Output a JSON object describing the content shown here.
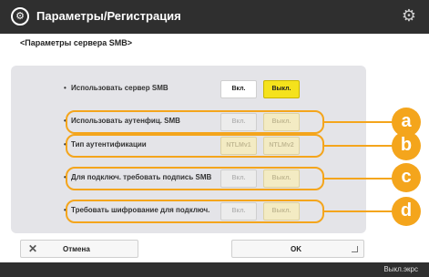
{
  "window": {
    "title": "Параметры/Регистрация",
    "title_icon": "settings-badge-icon",
    "gear_icon": "gear-icon"
  },
  "subheading": "<Параметры сервера SMB>",
  "rows": [
    {
      "label": "Использовать сервер SMB",
      "on": "Вкл.",
      "off": "Выкл.",
      "selected": "off",
      "enabled": true
    },
    {
      "label": "Использовать аутенфиц. SMB",
      "on": "Вкл.",
      "off": "Выкл.",
      "selected": "off",
      "enabled": false
    },
    {
      "label": "Тип аутентификации",
      "on": "NTLMv1",
      "off": "NTLMv2",
      "selected": "both",
      "enabled": false
    },
    {
      "label": "Для подключ. требовать подпись SMB",
      "on": "Вкл.",
      "off": "Выкл.",
      "selected": "off",
      "enabled": false
    },
    {
      "label": "Требовать шифрование для подключ.",
      "on": "Вкл.",
      "off": "Выкл.",
      "selected": "off",
      "enabled": false
    }
  ],
  "callouts": [
    "a",
    "b",
    "c",
    "d"
  ],
  "buttons": {
    "cancel": "Отмена",
    "cancel_icon": "close-icon",
    "ok": "OK"
  },
  "footer": {
    "text": "Выкл.экрс"
  },
  "colors": {
    "highlight": "#f4a51c",
    "selected": "#f5e21c",
    "titlebar": "#2f2f2f"
  }
}
